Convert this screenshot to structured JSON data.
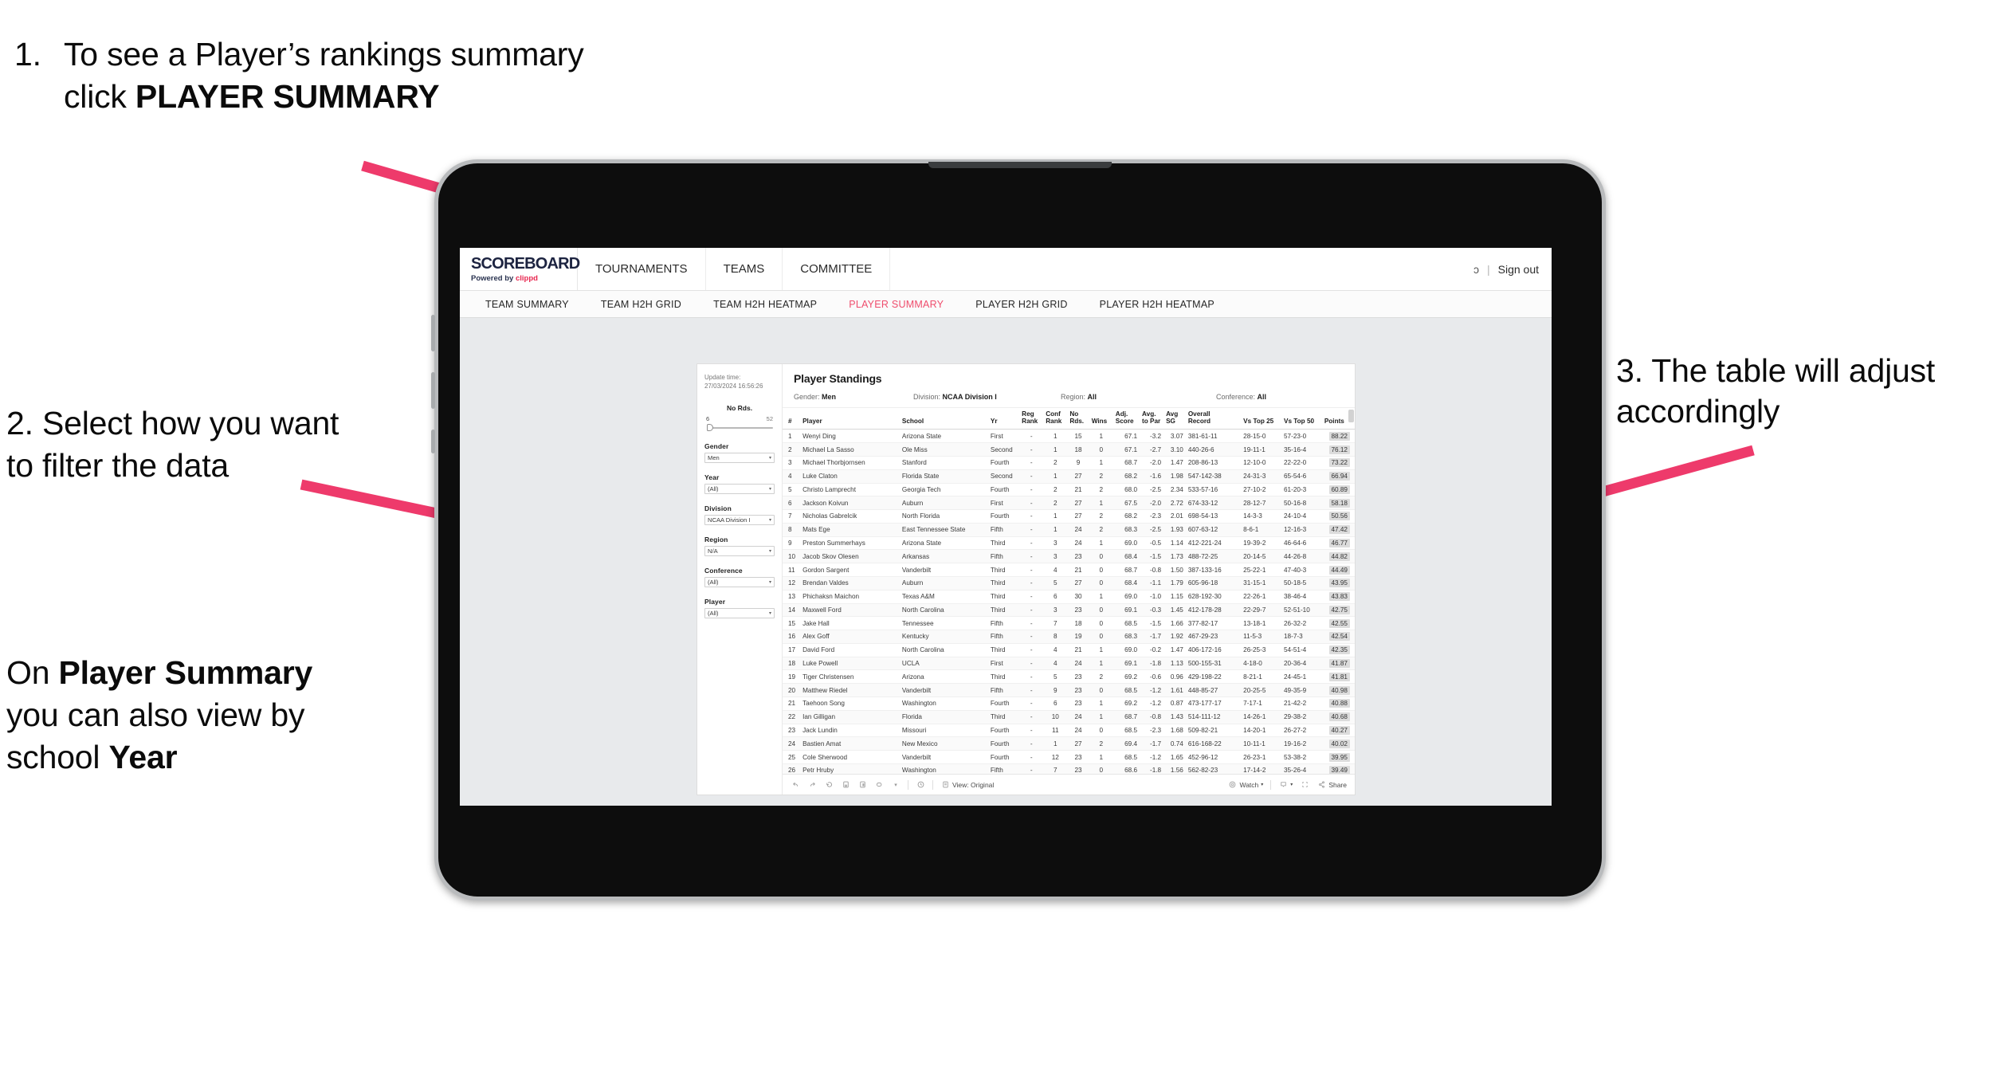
{
  "slide": {
    "callouts": [
      {
        "number": "1.",
        "text_before": "To see a Player’s rankings summary click ",
        "bold": "PLAYER SUMMARY"
      },
      {
        "number": "2.",
        "text": "2. Select how you want to filter the data"
      },
      {
        "text_a": "On ",
        "bold_a": "Player Summary",
        "text_b": " you can also view by school ",
        "bold_b": "Year"
      },
      {
        "text": "3. The table will adjust accordingly"
      }
    ],
    "arrow_color": "#ee3a6b"
  },
  "app": {
    "brand": {
      "logo": "SCOREBOARD",
      "powered_prefix": "Powered by ",
      "powered_brand": "clippd"
    },
    "nav": [
      {
        "label": "TOURNAMENTS"
      },
      {
        "label": "TEAMS"
      },
      {
        "label": "COMMITTEE"
      }
    ],
    "account": {
      "truncated": "ɔ",
      "separator": "|",
      "sign_out": "Sign out"
    },
    "tabs": [
      {
        "label": "TEAM SUMMARY",
        "active": false
      },
      {
        "label": "TEAM H2H GRID",
        "active": false
      },
      {
        "label": "TEAM H2H HEATMAP",
        "active": false
      },
      {
        "label": "PLAYER SUMMARY",
        "active": true
      },
      {
        "label": "PLAYER H2H GRID",
        "active": false
      },
      {
        "label": "PLAYER H2H HEATMAP",
        "active": false
      }
    ],
    "accent_color": "#ef4d6d"
  },
  "viz": {
    "update_time_label": "Update time:",
    "update_time_value": "27/03/2024 16:56:26",
    "title": "Player Standings",
    "header_filters": [
      {
        "label": "Gender:",
        "value": "Men"
      },
      {
        "label": "Division:",
        "value": "NCAA Division I"
      },
      {
        "label": "Region:",
        "value": "All"
      },
      {
        "label": "Conference:",
        "value": "All"
      }
    ],
    "filters": {
      "slider": {
        "title": "No Rds.",
        "min": "6",
        "max": "52"
      },
      "selects": [
        {
          "label": "Gender",
          "value": "Men"
        },
        {
          "label": "Year",
          "value": "(All)"
        },
        {
          "label": "Division",
          "value": "NCAA Division I"
        },
        {
          "label": "Region",
          "value": "N/A"
        },
        {
          "label": "Conference",
          "value": "(All)"
        },
        {
          "label": "Player",
          "value": "(All)"
        }
      ]
    },
    "toolbar": {
      "icons": [
        "undo-icon",
        "redo-icon",
        "revert-icon",
        "save-icon",
        "pause-icon",
        "refresh-icon",
        "dropdown-caret-icon",
        "history-icon"
      ],
      "view_label": "View: Original",
      "watch_label": "Watch",
      "share_label": "Share"
    }
  },
  "table": {
    "columns": [
      "#",
      "Player",
      "School",
      "Yr",
      "Reg\nRank",
      "Conf\nRank",
      "No\nRds.",
      "Wins",
      "Adj.\nScore",
      "Avg.\nto Par",
      "Avg\nSG",
      "Overall\nRecord",
      "Vs Top 25",
      "Vs Top 50",
      "Points"
    ],
    "rows": [
      [
        "1",
        "Wenyi Ding",
        "Arizona State",
        "First",
        "-",
        "1",
        "15",
        "1",
        "67.1",
        "-3.2",
        "3.07",
        "381-61-11",
        "28-15-0",
        "57-23-0",
        "88.22"
      ],
      [
        "2",
        "Michael La Sasso",
        "Ole Miss",
        "Second",
        "-",
        "1",
        "18",
        "0",
        "67.1",
        "-2.7",
        "3.10",
        "440-26-6",
        "19-11-1",
        "35-16-4",
        "76.12"
      ],
      [
        "3",
        "Michael Thorbjornsen",
        "Stanford",
        "Fourth",
        "-",
        "2",
        "9",
        "1",
        "68.7",
        "-2.0",
        "1.47",
        "208-86-13",
        "12-10-0",
        "22-22-0",
        "73.22"
      ],
      [
        "4",
        "Luke Claton",
        "Florida State",
        "Second",
        "-",
        "1",
        "27",
        "2",
        "68.2",
        "-1.6",
        "1.98",
        "547-142-38",
        "24-31-3",
        "65-54-6",
        "66.94"
      ],
      [
        "5",
        "Christo Lamprecht",
        "Georgia Tech",
        "Fourth",
        "-",
        "2",
        "21",
        "2",
        "68.0",
        "-2.5",
        "2.34",
        "533-57-16",
        "27-10-2",
        "61-20-3",
        "60.89"
      ],
      [
        "6",
        "Jackson Koivun",
        "Auburn",
        "First",
        "-",
        "2",
        "27",
        "1",
        "67.5",
        "-2.0",
        "2.72",
        "674-33-12",
        "28-12-7",
        "50-16-8",
        "58.18"
      ],
      [
        "7",
        "Nicholas Gabrelcik",
        "North Florida",
        "Fourth",
        "-",
        "1",
        "27",
        "2",
        "68.2",
        "-2.3",
        "2.01",
        "698-54-13",
        "14-3-3",
        "24-10-4",
        "50.56"
      ],
      [
        "8",
        "Mats Ege",
        "East Tennessee State",
        "Fifth",
        "-",
        "1",
        "24",
        "2",
        "68.3",
        "-2.5",
        "1.93",
        "607-63-12",
        "8-6-1",
        "12-16-3",
        "47.42"
      ],
      [
        "9",
        "Preston Summerhays",
        "Arizona State",
        "Third",
        "-",
        "3",
        "24",
        "1",
        "69.0",
        "-0.5",
        "1.14",
        "412-221-24",
        "19-39-2",
        "46-64-6",
        "46.77"
      ],
      [
        "10",
        "Jacob Skov Olesen",
        "Arkansas",
        "Fifth",
        "-",
        "3",
        "23",
        "0",
        "68.4",
        "-1.5",
        "1.73",
        "488-72-25",
        "20-14-5",
        "44-26-8",
        "44.82"
      ],
      [
        "11",
        "Gordon Sargent",
        "Vanderbilt",
        "Third",
        "-",
        "4",
        "21",
        "0",
        "68.7",
        "-0.8",
        "1.50",
        "387-133-16",
        "25-22-1",
        "47-40-3",
        "44.49"
      ],
      [
        "12",
        "Brendan Valdes",
        "Auburn",
        "Third",
        "-",
        "5",
        "27",
        "0",
        "68.4",
        "-1.1",
        "1.79",
        "605-96-18",
        "31-15-1",
        "50-18-5",
        "43.95"
      ],
      [
        "13",
        "Phichaksn Maichon",
        "Texas A&M",
        "Third",
        "-",
        "6",
        "30",
        "1",
        "69.0",
        "-1.0",
        "1.15",
        "628-192-30",
        "22-26-1",
        "38-46-4",
        "43.83"
      ],
      [
        "14",
        "Maxwell Ford",
        "North Carolina",
        "Third",
        "-",
        "3",
        "23",
        "0",
        "69.1",
        "-0.3",
        "1.45",
        "412-178-28",
        "22-29-7",
        "52-51-10",
        "42.75"
      ],
      [
        "15",
        "Jake Hall",
        "Tennessee",
        "Fifth",
        "-",
        "7",
        "18",
        "0",
        "68.5",
        "-1.5",
        "1.66",
        "377-82-17",
        "13-18-1",
        "26-32-2",
        "42.55"
      ],
      [
        "16",
        "Alex Goff",
        "Kentucky",
        "Fifth",
        "-",
        "8",
        "19",
        "0",
        "68.3",
        "-1.7",
        "1.92",
        "467-29-23",
        "11-5-3",
        "18-7-3",
        "42.54"
      ],
      [
        "17",
        "David Ford",
        "North Carolina",
        "Third",
        "-",
        "4",
        "21",
        "1",
        "69.0",
        "-0.2",
        "1.47",
        "406-172-16",
        "26-25-3",
        "54-51-4",
        "42.35"
      ],
      [
        "18",
        "Luke Powell",
        "UCLA",
        "First",
        "-",
        "4",
        "24",
        "1",
        "69.1",
        "-1.8",
        "1.13",
        "500-155-31",
        "4-18-0",
        "20-36-4",
        "41.87"
      ],
      [
        "19",
        "Tiger Christensen",
        "Arizona",
        "Third",
        "-",
        "5",
        "23",
        "2",
        "69.2",
        "-0.6",
        "0.96",
        "429-198-22",
        "8-21-1",
        "24-45-1",
        "41.81"
      ],
      [
        "20",
        "Matthew Riedel",
        "Vanderbilt",
        "Fifth",
        "-",
        "9",
        "23",
        "0",
        "68.5",
        "-1.2",
        "1.61",
        "448-85-27",
        "20-25-5",
        "49-35-9",
        "40.98"
      ],
      [
        "21",
        "Taehoon Song",
        "Washington",
        "Fourth",
        "-",
        "6",
        "23",
        "1",
        "69.2",
        "-1.2",
        "0.87",
        "473-177-17",
        "7-17-1",
        "21-42-2",
        "40.88"
      ],
      [
        "22",
        "Ian Gilligan",
        "Florida",
        "Third",
        "-",
        "10",
        "24",
        "1",
        "68.7",
        "-0.8",
        "1.43",
        "514-111-12",
        "14-26-1",
        "29-38-2",
        "40.68"
      ],
      [
        "23",
        "Jack Lundin",
        "Missouri",
        "Fourth",
        "-",
        "11",
        "24",
        "0",
        "68.5",
        "-2.3",
        "1.68",
        "509-82-21",
        "14-20-1",
        "26-27-2",
        "40.27"
      ],
      [
        "24",
        "Bastien Amat",
        "New Mexico",
        "Fourth",
        "-",
        "1",
        "27",
        "2",
        "69.4",
        "-1.7",
        "0.74",
        "616-168-22",
        "10-11-1",
        "19-16-2",
        "40.02"
      ],
      [
        "25",
        "Cole Sherwood",
        "Vanderbilt",
        "Fourth",
        "-",
        "12",
        "23",
        "1",
        "68.5",
        "-1.2",
        "1.65",
        "452-96-12",
        "26-23-1",
        "53-38-2",
        "39.95"
      ],
      [
        "26",
        "Petr Hruby",
        "Washington",
        "Fifth",
        "-",
        "7",
        "23",
        "0",
        "68.6",
        "-1.8",
        "1.56",
        "562-82-23",
        "17-14-2",
        "35-26-4",
        "39.49"
      ]
    ]
  }
}
